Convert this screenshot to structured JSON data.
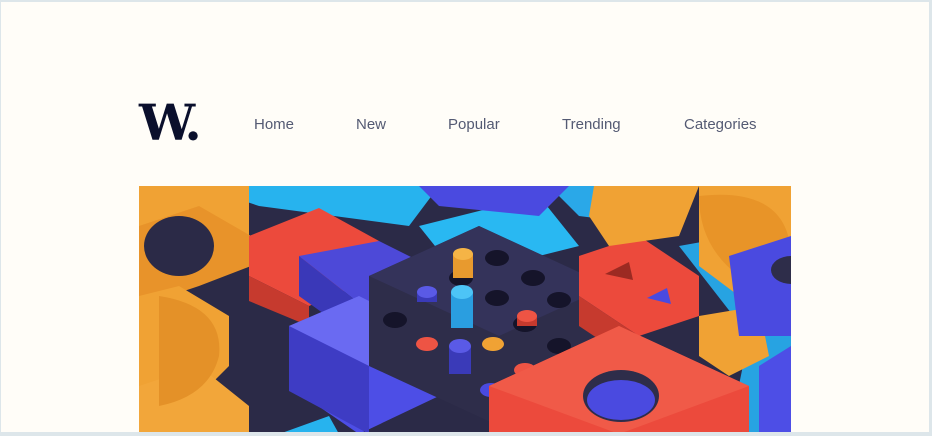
{
  "logo": {
    "text": "W."
  },
  "nav": {
    "items": [
      {
        "label": "Home"
      },
      {
        "label": "New"
      },
      {
        "label": "Popular"
      },
      {
        "label": "Trending"
      },
      {
        "label": "Categories"
      }
    ]
  },
  "hero": {
    "colors": {
      "orange": "#f0a234",
      "red": "#ec4a3c",
      "blue": "#4a4ae0",
      "cyan": "#26b6f0",
      "navy": "#2e2d4a"
    }
  }
}
